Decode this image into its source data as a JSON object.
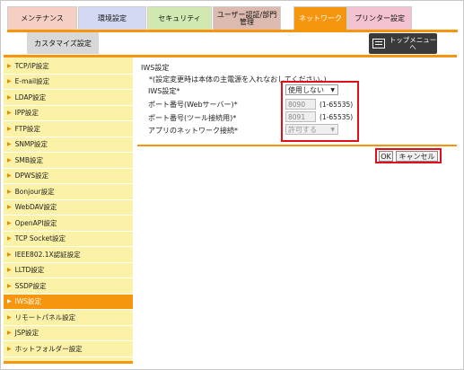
{
  "tabs": {
    "maintenance": "メンテナンス",
    "environment": "環境設定",
    "security": "セキュリティ",
    "user_auth_line1": "ユーザー認証/部門",
    "user_auth_line2": "管理",
    "network": "ネットワーク",
    "printer": "プリンター設定"
  },
  "subtab": {
    "customize": "カスタマイズ設定"
  },
  "topmenu": {
    "line1": "トップメニュー",
    "line2": "へ"
  },
  "sidebar": {
    "items": [
      {
        "label": "TCP/IP設定"
      },
      {
        "label": "E-mail設定"
      },
      {
        "label": "LDAP設定"
      },
      {
        "label": "IPP設定"
      },
      {
        "label": "FTP設定"
      },
      {
        "label": "SNMP設定"
      },
      {
        "label": "SMB設定"
      },
      {
        "label": "DPWS設定"
      },
      {
        "label": "Bonjour設定"
      },
      {
        "label": "WebDAV設定"
      },
      {
        "label": "OpenAPI設定"
      },
      {
        "label": "TCP Socket設定"
      },
      {
        "label": "IEEE802.1X認証設定"
      },
      {
        "label": "LLTD設定"
      },
      {
        "label": "SSDP設定"
      },
      {
        "label": "IWS設定"
      },
      {
        "label": "リモートパネル設定"
      },
      {
        "label": "JSP設定"
      },
      {
        "label": "ホットフォルダー設定"
      }
    ],
    "active_index": 15
  },
  "content": {
    "title": "IWS設定",
    "note": "*(設定変更時は本体の主電源を入れなおしてください。)",
    "iws_label": "IWS設定*",
    "iws_value": "使用しない",
    "port_web_label": "ポート番号(Webサーバー)*",
    "port_web_value": "8090",
    "port_web_range": "(1-65535)",
    "port_tool_label": "ポート番号(ツール接続用)*",
    "port_tool_value": "8091",
    "port_tool_range": "(1-65535)",
    "app_net_label": "アプリのネットワーク接続*",
    "app_net_value": "許可する"
  },
  "buttons": {
    "ok": "OK",
    "cancel": "キャンセル"
  },
  "colors": {
    "accent": "#f6960e",
    "highlight": "#e0101a",
    "sidebar_bg": "#fbf1a7"
  }
}
